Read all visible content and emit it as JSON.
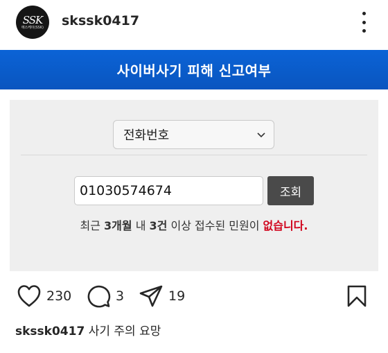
{
  "post": {
    "username": "skssk0417",
    "avatar": {
      "logo": "SSK",
      "subtext": "에스케이(SSK)"
    },
    "more_icon": "more-vertical-icon"
  },
  "content": {
    "banner_title": "사이버사기 피해 신고여부",
    "select_value": "전화번호",
    "phone_value": "01030574674",
    "search_button": "조회",
    "result_parts": [
      "최근 ",
      "3개월",
      " 내 ",
      "3건",
      " 이상 접수된 민원이 ",
      "없습니다."
    ],
    "colors": {
      "banner": "#0b63d6",
      "panel": "#efefef",
      "button": "#4a4a4a",
      "alert": "#d0021b"
    }
  },
  "actions": {
    "likes": "230",
    "comments": "3",
    "shares": "19",
    "icons": [
      "heart-icon",
      "comment-icon",
      "send-icon",
      "bookmark-icon"
    ]
  },
  "caption": {
    "username": "skssk0417",
    "text": "사기 주의 요망"
  }
}
